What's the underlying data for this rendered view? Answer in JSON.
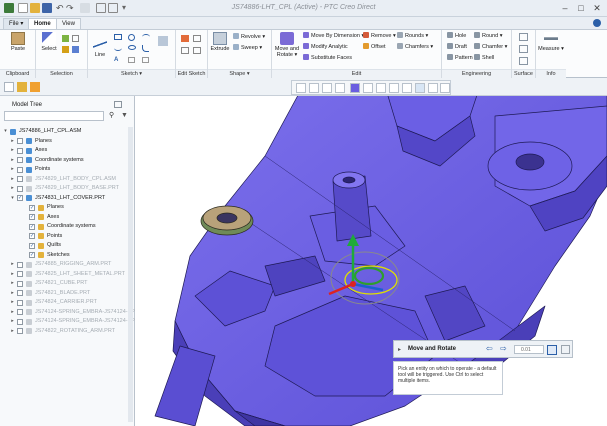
{
  "window": {
    "title": "JS74886-LHT_CPL (Active) - PTC Creo Direct"
  },
  "tabs": [
    {
      "label": "File"
    },
    {
      "label": "Home"
    },
    {
      "label": "View"
    }
  ],
  "ribbon": {
    "groups": [
      {
        "label": "Clipboard"
      },
      {
        "label": "Selection"
      },
      {
        "label": "Sketch"
      },
      {
        "label": "Edit Sketch"
      },
      {
        "label": "Shape"
      },
      {
        "label": "Edit"
      },
      {
        "label": "Engineering"
      },
      {
        "label": "Surface"
      },
      {
        "label": "Info"
      }
    ],
    "clipboard": {
      "paste": "Paste"
    },
    "selection": {
      "select": "Select"
    },
    "sketch": {
      "line": "Line"
    },
    "shape": {
      "extrude": "Extrude",
      "revolve": "Revolve",
      "sweep": "Sweep"
    },
    "edit": {
      "move_rotate": "Move and Rotate",
      "move_by_dimension": "Move By Dimension",
      "modify_analytic": "Modify Analytic",
      "substitute_faces": "Substitute Faces",
      "remove": "Remove",
      "offset": "Offset",
      "rounds": "Rounds",
      "chamfers": "Chamfers"
    },
    "engineering": {
      "hole": "Hole",
      "draft": "Draft",
      "pattern": "Pattern",
      "round": "Round",
      "chamfer": "Chamfer",
      "shell": "Shell"
    },
    "info": {
      "measure": "Measure"
    }
  },
  "model_tree": {
    "title": "Model Tree",
    "items": [
      {
        "label": "JS74886_LHT_CPL.ASM",
        "level": 0,
        "state": "root"
      },
      {
        "label": "Planes",
        "level": 1,
        "state": "normal"
      },
      {
        "label": "Axes",
        "level": 1,
        "state": "normal"
      },
      {
        "label": "Coordinate systems",
        "level": 1,
        "state": "normal"
      },
      {
        "label": "Points",
        "level": 1,
        "state": "normal"
      },
      {
        "label": "JS74829_LHT_BODY_CPL.ASM",
        "level": 1,
        "state": "dim"
      },
      {
        "label": "JS74829_LHT_BODY_BASE.PRT",
        "level": 1,
        "state": "dim"
      },
      {
        "label": "JS74831_LHT_COVER.PRT",
        "level": 1,
        "state": "checked"
      },
      {
        "label": "Planes",
        "level": 2,
        "state": "checked"
      },
      {
        "label": "Axes",
        "level": 2,
        "state": "checked"
      },
      {
        "label": "Coordinate systems",
        "level": 2,
        "state": "checked"
      },
      {
        "label": "Points",
        "level": 2,
        "state": "checked"
      },
      {
        "label": "Quilts",
        "level": 2,
        "state": "checked"
      },
      {
        "label": "Sketches",
        "level": 2,
        "state": "checked"
      },
      {
        "label": "JS74885_RIGGING_ARM.PRT",
        "level": 1,
        "state": "dim"
      },
      {
        "label": "JS74825_LHT_SHEET_METAL.PRT",
        "level": 1,
        "state": "dim"
      },
      {
        "label": "JS74821_CUBE.PRT",
        "level": 1,
        "state": "dim"
      },
      {
        "label": "JS74821_BLADE.PRT",
        "level": 1,
        "state": "dim"
      },
      {
        "label": "JS74824_CARRIER.PRT",
        "level": 1,
        "state": "dim"
      },
      {
        "label": "JS74124-SPRING_EMBRA-JS74124-SPRI",
        "level": 1,
        "state": "dim"
      },
      {
        "label": "JS74124-SPRING_EMBRA-JS74124-SPRI",
        "level": 1,
        "state": "dim"
      },
      {
        "label": "JS74822_ROTATING_ARM.PRT",
        "level": 1,
        "state": "dim"
      }
    ]
  },
  "move_panel": {
    "title": "Move and Rotate",
    "value": "0.01",
    "tip": "Pick an entity on which to operate - a default tool will be triggered. Use Ctrl to select multiple items."
  },
  "colors": {
    "model": "#6a5ee0",
    "model_dark": "#4a3fb8",
    "edge": "#1e1a55",
    "accent": "#2b5fa8"
  }
}
